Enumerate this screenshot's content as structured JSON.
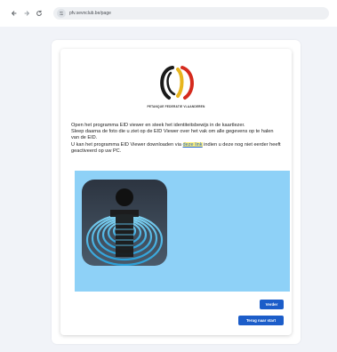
{
  "browser": {
    "url": "pfv.sevnclub.be/page"
  },
  "header": {
    "logo_caption": "PETANQUE FEDERATIE VLAANDEREN"
  },
  "instructions": {
    "line1": "Open het programma EID viewer en steek het identiteitsbewijs in de kaartlezer.",
    "line2": "Sleep daarna de foto die u ziet op de EID Viewer over het vak om alle gegevens op te halen van de EID.",
    "line3_before": "U kan het programma EID Viewer downloaden via ",
    "link_label": "deze link",
    "line3_after": " indien u deze nog niet eerder heeft geactiveerd op uw PC."
  },
  "buttons": {
    "next_label": "Verder",
    "back_label": "Terug naar start"
  },
  "colors": {
    "photo_zone": "#8ed1f7",
    "button": "#1c5dc9",
    "link_highlight": "#fff27a"
  },
  "icons": {
    "back": "arrow-left-icon",
    "forward": "arrow-right-icon",
    "reload": "reload-icon",
    "site": "site-info-icon",
    "logo": "pfv-logo",
    "eid": "eid-viewer-icon"
  }
}
